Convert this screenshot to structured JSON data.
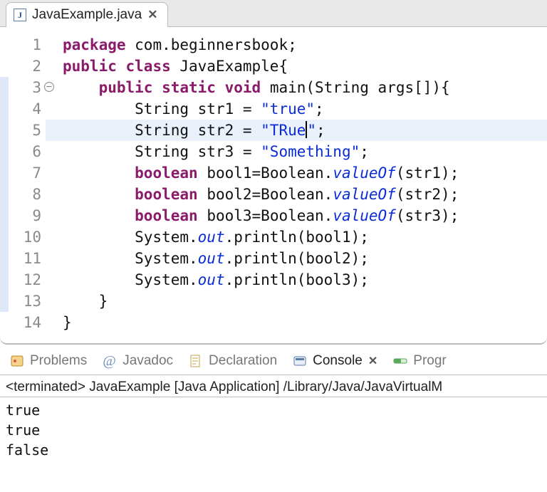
{
  "tab": {
    "filename": "JavaExample.java"
  },
  "code": {
    "lines": [
      {
        "n": 1,
        "indent": 0,
        "bp": false,
        "fold": false,
        "tokens": [
          [
            "kw",
            "package"
          ],
          [
            "",
            " com.beginnersbook;"
          ]
        ]
      },
      {
        "n": 2,
        "indent": 0,
        "bp": false,
        "fold": false,
        "tokens": [
          [
            "kw",
            "public"
          ],
          [
            "",
            " "
          ],
          [
            "kw",
            "class"
          ],
          [
            "",
            " JavaExample{"
          ]
        ]
      },
      {
        "n": 3,
        "indent": 1,
        "bp": true,
        "fold": true,
        "tokens": [
          [
            "kw",
            "public"
          ],
          [
            "",
            " "
          ],
          [
            "kw",
            "static"
          ],
          [
            "",
            " "
          ],
          [
            "kw",
            "void"
          ],
          [
            "",
            " main(String args[]){"
          ]
        ]
      },
      {
        "n": 4,
        "indent": 2,
        "bp": true,
        "fold": false,
        "tokens": [
          [
            "",
            "String str1 = "
          ],
          [
            "str",
            "\"true\""
          ],
          [
            "",
            ";"
          ]
        ]
      },
      {
        "n": 5,
        "indent": 2,
        "bp": true,
        "fold": false,
        "hl": true,
        "caretAfter": 3,
        "tokens": [
          [
            "",
            "String str2 = "
          ],
          [
            "str",
            "\"TRue"
          ],
          [
            "caret",
            ""
          ],
          [
            "str",
            "\""
          ],
          [
            "",
            ";"
          ]
        ]
      },
      {
        "n": 6,
        "indent": 2,
        "bp": true,
        "fold": false,
        "tokens": [
          [
            "",
            "String str3 = "
          ],
          [
            "str",
            "\"Something\""
          ],
          [
            "",
            ";"
          ]
        ]
      },
      {
        "n": 7,
        "indent": 2,
        "bp": true,
        "fold": false,
        "tokens": [
          [
            "kw",
            "boolean"
          ],
          [
            "",
            " bool1=Boolean."
          ],
          [
            "it",
            "valueOf"
          ],
          [
            "",
            "(str1);"
          ]
        ]
      },
      {
        "n": 8,
        "indent": 2,
        "bp": true,
        "fold": false,
        "tokens": [
          [
            "kw",
            "boolean"
          ],
          [
            "",
            " bool2=Boolean."
          ],
          [
            "it",
            "valueOf"
          ],
          [
            "",
            "(str2);"
          ]
        ]
      },
      {
        "n": 9,
        "indent": 2,
        "bp": true,
        "fold": false,
        "tokens": [
          [
            "kw",
            "boolean"
          ],
          [
            "",
            " bool3=Boolean."
          ],
          [
            "it",
            "valueOf"
          ],
          [
            "",
            "(str3);"
          ]
        ]
      },
      {
        "n": 10,
        "indent": 2,
        "bp": true,
        "fold": false,
        "tokens": [
          [
            "",
            "System."
          ],
          [
            "it",
            "out"
          ],
          [
            "",
            ".println(bool1);"
          ]
        ]
      },
      {
        "n": 11,
        "indent": 2,
        "bp": true,
        "fold": false,
        "tokens": [
          [
            "",
            "System."
          ],
          [
            "it",
            "out"
          ],
          [
            "",
            ".println(bool2);"
          ]
        ]
      },
      {
        "n": 12,
        "indent": 2,
        "bp": true,
        "fold": false,
        "tokens": [
          [
            "",
            "System."
          ],
          [
            "it",
            "out"
          ],
          [
            "",
            ".println(bool3);"
          ]
        ]
      },
      {
        "n": 13,
        "indent": 1,
        "bp": true,
        "fold": false,
        "tokens": [
          [
            "",
            "}"
          ]
        ]
      },
      {
        "n": 14,
        "indent": 0,
        "bp": false,
        "fold": false,
        "tokens": [
          [
            "",
            "}"
          ]
        ]
      }
    ]
  },
  "views": {
    "items": [
      {
        "id": "problems",
        "label": "Problems"
      },
      {
        "id": "javadoc",
        "label": "Javadoc"
      },
      {
        "id": "declaration",
        "label": "Declaration"
      },
      {
        "id": "console",
        "label": "Console",
        "active": true
      },
      {
        "id": "progress",
        "label": "Progr"
      }
    ]
  },
  "console": {
    "status": "<terminated> JavaExample [Java Application] /Library/Java/JavaVirtualM",
    "output": [
      "true",
      "true",
      "false"
    ]
  }
}
